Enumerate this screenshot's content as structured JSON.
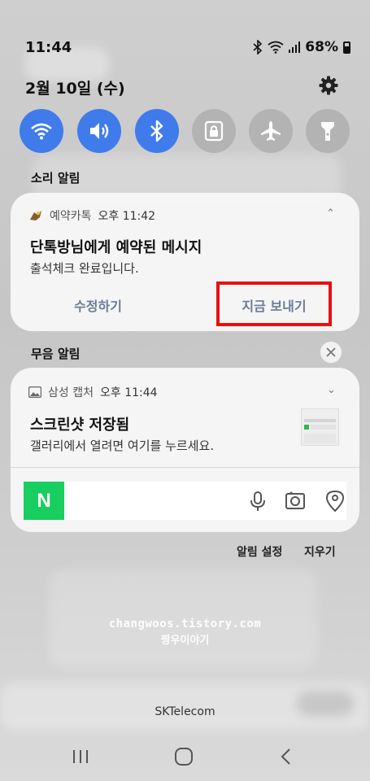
{
  "status_bar": {
    "time": "11:44",
    "battery": "68%",
    "icons": [
      "bluetooth-icon",
      "wifi-icon",
      "cell-signal-icon",
      "battery-icon"
    ]
  },
  "date": "2월 10일 (수)",
  "quick_settings": [
    {
      "name": "wifi",
      "icon": "wifi-icon",
      "active": true
    },
    {
      "name": "sound",
      "icon": "speaker-icon",
      "active": true
    },
    {
      "name": "bluetooth",
      "icon": "bluetooth-icon",
      "active": true
    },
    {
      "name": "rotation-lock",
      "icon": "lock-icon",
      "active": false
    },
    {
      "name": "airplane",
      "icon": "airplane-icon",
      "active": false
    },
    {
      "name": "flashlight",
      "icon": "flashlight-icon",
      "active": false
    }
  ],
  "sound_section_title": "소리 알림",
  "kakao_notification": {
    "app_name": "예약카톡",
    "time": "오후 11:42",
    "title": "단톡방님에게 예약된 메시지",
    "body": "출석체크 완료입니다.",
    "actions": [
      "수정하기",
      "지금 보내기"
    ]
  },
  "silent_section_title": "무음 알림",
  "capture_notification": {
    "app_name": "삼성 캡처",
    "time": "오후 11:44",
    "title": "스크린샷 저장됨",
    "body": "갤러리에서 열려면 여기를 누르세요."
  },
  "naver": {
    "logo": "N",
    "icons": [
      "microphone-icon",
      "lens-icon",
      "location-icon"
    ]
  },
  "footer": {
    "settings": "알림 설정",
    "clear": "지우기"
  },
  "watermark": {
    "line1": "changwoos.tistory.com",
    "line2": "짱우이야기"
  },
  "carrier": "SKTelecom",
  "colors": {
    "accent": "#3f7bea",
    "inactive_toggle": "#b3b3b3",
    "highlight": "#e81010",
    "naver_green": "#19ce60"
  }
}
